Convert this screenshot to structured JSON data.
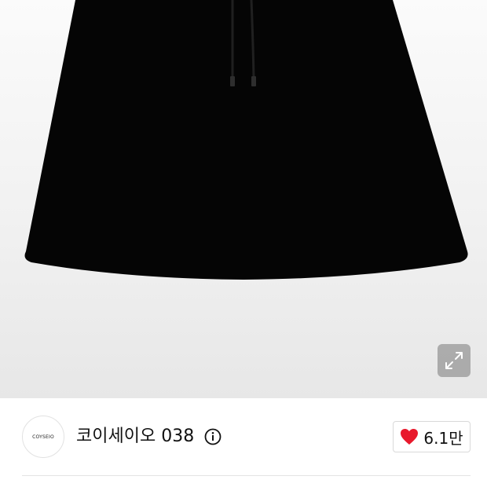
{
  "brand": {
    "logo_text": "COYSEIO",
    "name": "코이세이오 038"
  },
  "like": {
    "count": "6.1만",
    "color": "#e8192c"
  },
  "icons": {
    "expand": "expand-icon",
    "info": "info-icon",
    "heart": "heart-icon"
  }
}
